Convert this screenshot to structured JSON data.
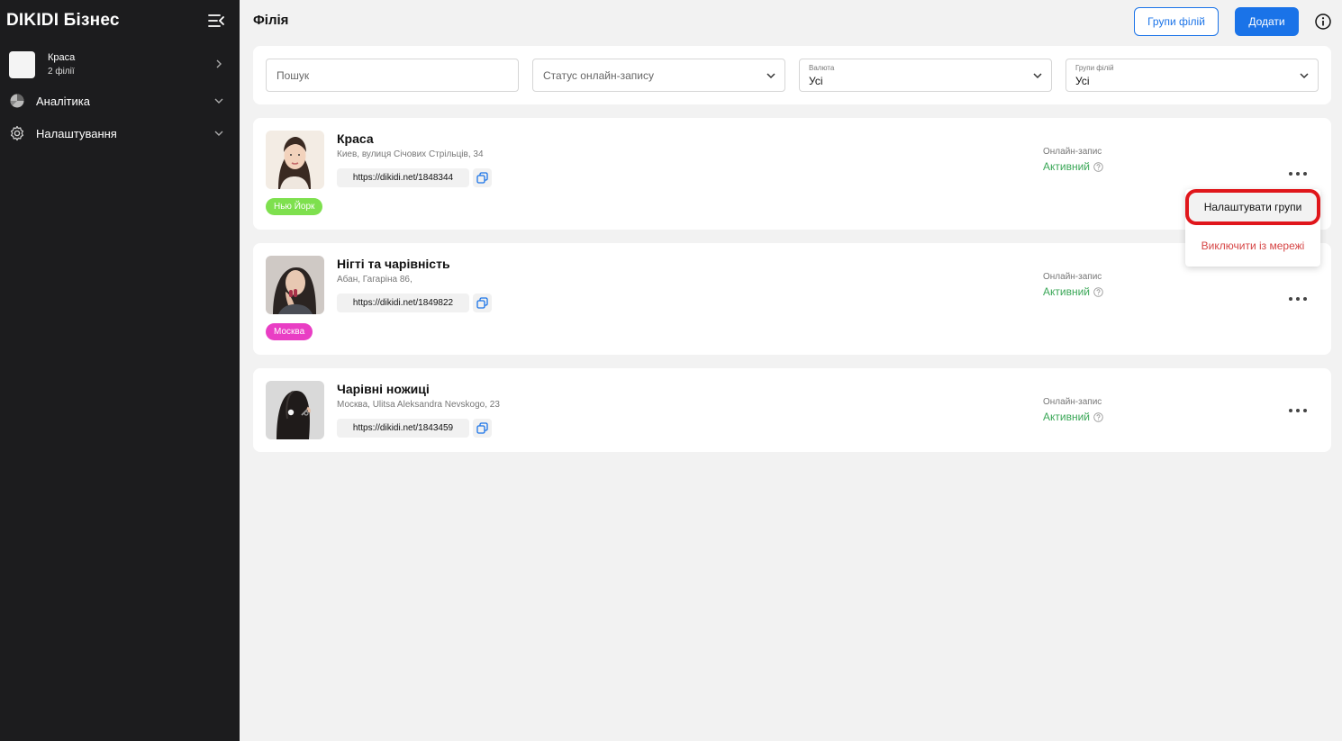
{
  "sidebar": {
    "brand": "DIKIDI Бізнес",
    "account": {
      "name": "Краса",
      "sub": "2 філії"
    },
    "items": [
      {
        "label": "Аналітика",
        "icon": "pie-chart-icon"
      },
      {
        "label": "Налаштування",
        "icon": "gear-icon"
      }
    ]
  },
  "header": {
    "title": "Філія",
    "groups_button": "Групи філій",
    "add_button": "Додати"
  },
  "filters": {
    "search_placeholder": "Пошук",
    "status_placeholder": "Статус онлайн-запису",
    "currency_label": "Валюта",
    "currency_value": "Усі",
    "groups_label": "Групи філій",
    "groups_value": "Усі"
  },
  "branches": [
    {
      "title": "Краса",
      "address": "Киев, вулиця Січових Стрільців, 34",
      "link": "https://dikidi.net/1848344",
      "tag": "Нью Йорк",
      "tag_color": "#7ee04e",
      "online_label": "Онлайн-запис",
      "online_status": "Активний"
    },
    {
      "title": "Нігті та чарівність",
      "address": "Абан, Гагаріна 86,",
      "link": "https://dikidi.net/1849822",
      "tag": "Москва",
      "tag_color": "#e93ec4",
      "online_label": "Онлайн-запис",
      "online_status": "Активний"
    },
    {
      "title": "Чарівні ножиці",
      "address": "Москва, Ulitsa Aleksandra Nevskogo, 23",
      "link": "https://dikidi.net/1843459",
      "online_label": "Онлайн-запис",
      "online_status": "Активний"
    }
  ],
  "menu": {
    "configure_groups": "Налаштувати групи",
    "exclude": "Виключити із мережі"
  },
  "colors": {
    "accent": "#1a73e8",
    "sidebar": "#1c1c1e",
    "active": "#3aa757",
    "danger": "#d64545",
    "highlight": "#e0161b"
  }
}
